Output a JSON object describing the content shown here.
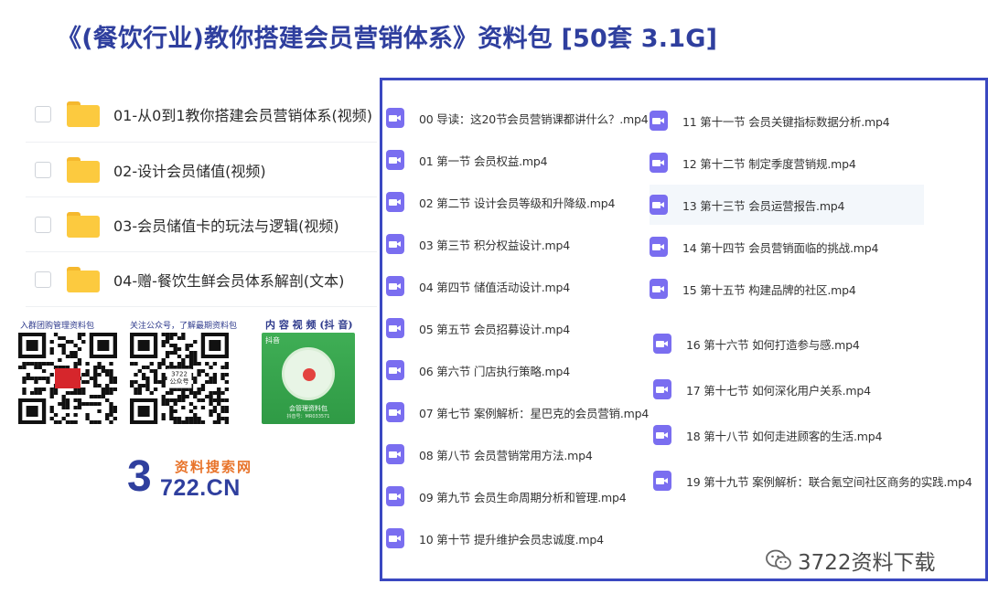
{
  "title": "《(餐饮行业)教你搭建会员营销体系》资料包 [50套 3.1G]",
  "folders": [
    {
      "label": "01-从0到1教你搭建会员营销体系(视频)"
    },
    {
      "label": "02-设计会员储值(视频)"
    },
    {
      "label": "03-会员储值卡的玩法与逻辑(视频)"
    },
    {
      "label": "04-赠-餐饮生鲜会员体系解剖(文本)"
    }
  ],
  "qr": {
    "caption_left": "入群团购管理资料包",
    "caption_middle": "关注公众号，了解最期资料包",
    "middle_center_line1": "3722",
    "middle_center_line2": "公众号",
    "video_caption": "内 容 视 频 (抖 音)",
    "douyin_app": "抖音",
    "douyin_name": "会管理资料包",
    "douyin_id": "抖音号：MR033571"
  },
  "logo": {
    "top": "资料搜索网",
    "digit": "3",
    "rest": "722.CN"
  },
  "files_left": [
    "00 导读：这20节会员营销课都讲什么？.mp4",
    "01 第一节 会员权益.mp4",
    "02 第二节 设计会员等级和升降级.mp4",
    "03 第三节 积分权益设计.mp4",
    "04 第四节 储值活动设计.mp4",
    "05 第五节 会员招募设计.mp4",
    "06 第六节 门店执行策略.mp4",
    "07 第七节 案例解析：星巴克的会员营销.mp4",
    "08 第八节 会员营销常用方法.mp4",
    "09 第九节 会员生命周期分析和管理.mp4",
    "10 第十节 提升维护会员忠诚度.mp4"
  ],
  "files_right": [
    "11 第十一节 会员关键指标数据分析.mp4",
    "12 第十二节 制定季度营销规.mp4",
    "13 第十三节 会员运营报告.mp4",
    "14 第十四节 会员营销面临的挑战.mp4",
    "15 第十五节 构建品牌的社区.mp4",
    "16 第十六节 如何打造参与感.mp4",
    "17 第十七节 如何深化用户关系.mp4",
    "18 第十八节 如何走进顾客的生活.mp4",
    "19 第十九节 案例解析：联合氪空间社区商务的实践.mp4"
  ],
  "watermark": {
    "text": "3722资料下载",
    "icon": "wechat-icon"
  },
  "colors": {
    "title": "#2f3f9e",
    "panel_border": "#3a48c1",
    "video_icon": "#7a6ef0",
    "folder": "#fcca3f",
    "logo_orange": "#e8742b"
  }
}
